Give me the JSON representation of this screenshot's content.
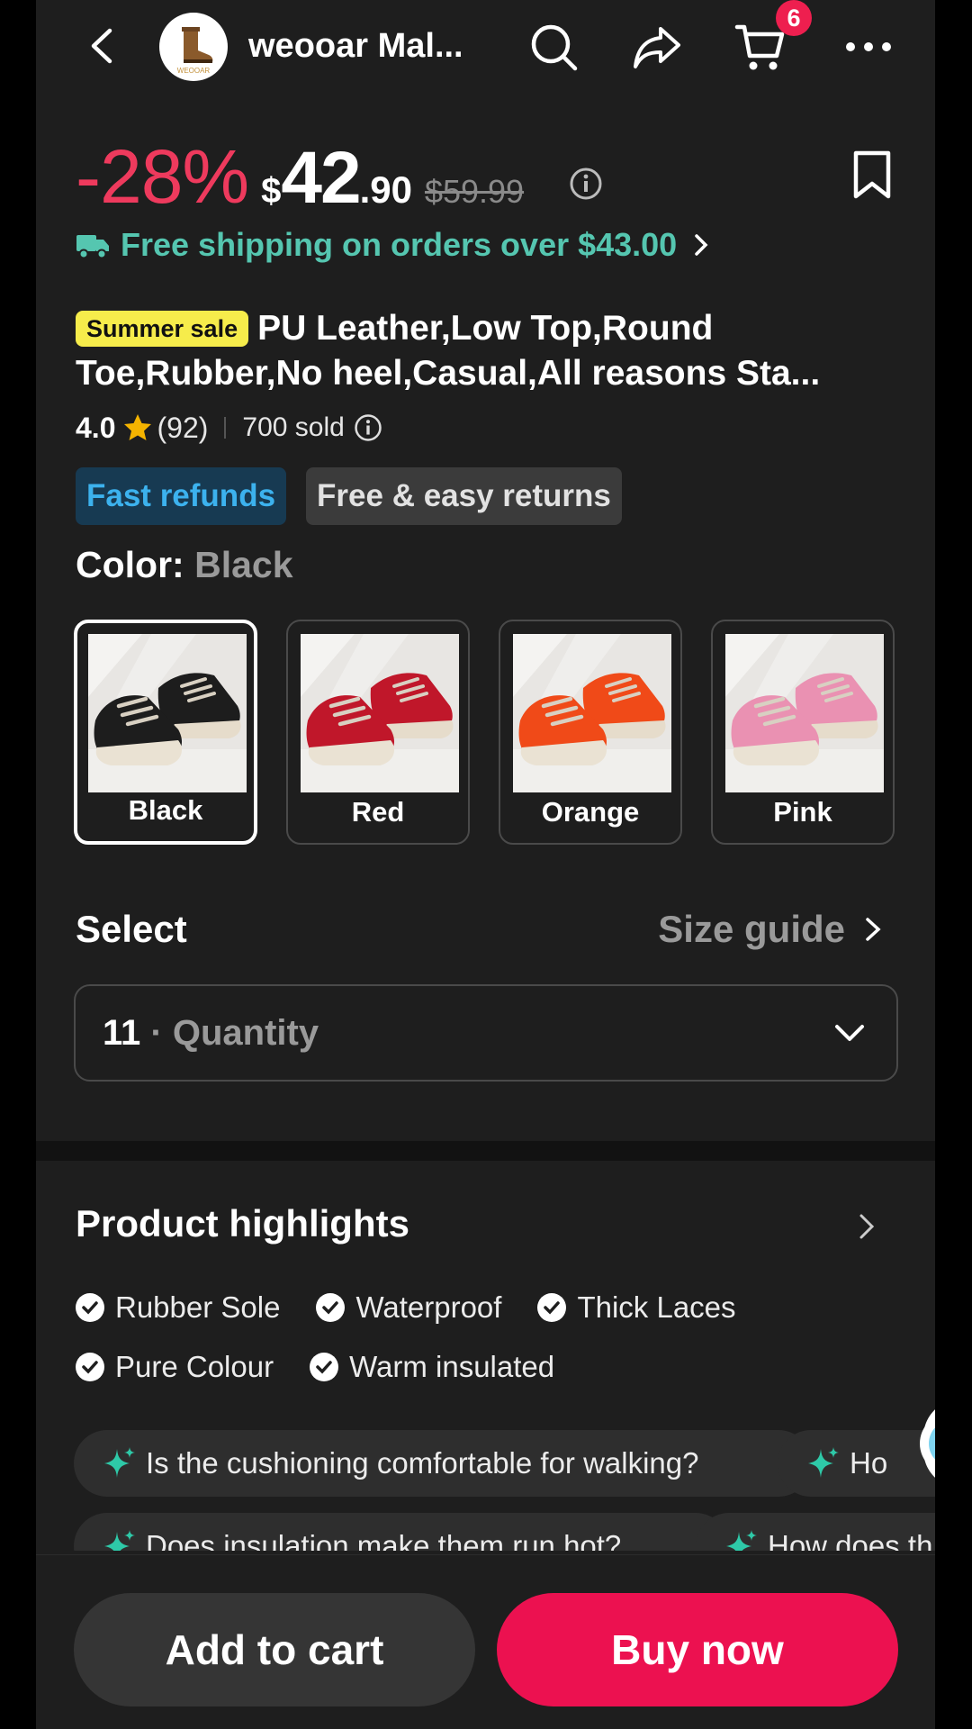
{
  "header": {
    "store_name": "weooar Mal...",
    "logo_text": "WEOOAR",
    "cart_count": "6"
  },
  "price": {
    "discount": "-28%",
    "currency": "$",
    "integer": "42",
    "decimal": ".90",
    "original": "$59.99"
  },
  "shipping": {
    "text": "Free shipping on orders over $43.00"
  },
  "product": {
    "tag": "Summer sale",
    "title": "PU Leather,Low Top,Round Toe,Rubber,No heel,Casual,All reasons Sta...",
    "rating": "4.0",
    "reviews": "(92)",
    "sold": "700 sold"
  },
  "badges": {
    "fast_refunds": "Fast refunds",
    "free_returns": "Free & easy returns"
  },
  "color": {
    "label": "Color:",
    "selected": "Black",
    "options": [
      {
        "label": "Black",
        "shoe": "#1d1d1d"
      },
      {
        "label": "Red",
        "shoe": "#c0172a"
      },
      {
        "label": "Orange",
        "shoe": "#f04a18"
      },
      {
        "label": "Pink",
        "shoe": "#ea91b2"
      }
    ]
  },
  "select": {
    "label": "Select",
    "size_guide": "Size guide",
    "value": "11",
    "separator": " · ",
    "placeholder": "Quantity"
  },
  "highlights": {
    "title": "Product highlights",
    "items": [
      "Rubber Sole",
      "Waterproof",
      "Thick Laces",
      "Pure Colour",
      "Warm insulated"
    ],
    "questions": [
      "Is the cushioning comfortable for walking?",
      "Ho",
      "Does insulation make them run hot?",
      "How does th"
    ]
  },
  "actions": {
    "add_to_cart": "Add to cart",
    "buy_now": "Buy now"
  },
  "colors": {
    "accent": "#ec1150",
    "discount": "#ee3a5d",
    "shipping": "#55c6b0",
    "sale_tag": "#f6ec4b",
    "refund": "#3cb2ee"
  }
}
